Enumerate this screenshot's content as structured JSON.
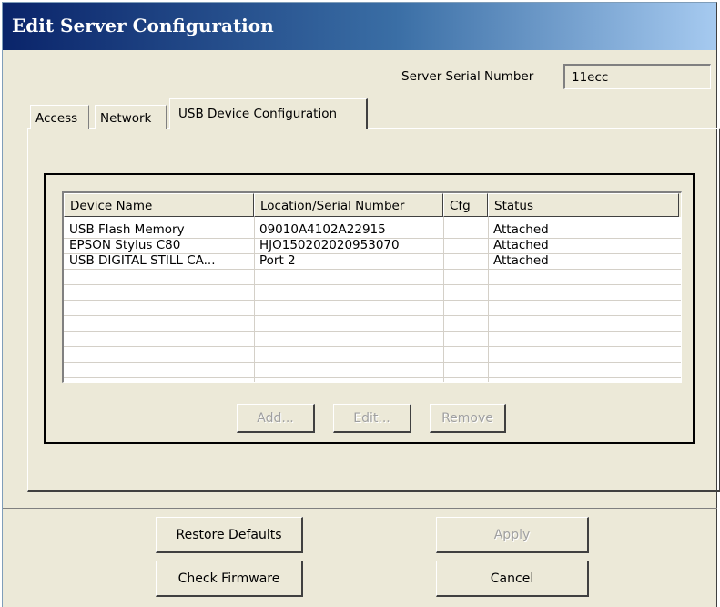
{
  "window": {
    "title": "Edit Server Configuration"
  },
  "server_serial": {
    "label": "Server Serial Number",
    "value": "11ecc"
  },
  "tabs": [
    {
      "label": "Access"
    },
    {
      "label": "Network"
    },
    {
      "label": "USB Device Configuration"
    }
  ],
  "device_list": {
    "columns": [
      "Device Name",
      "Location/Serial Number",
      "Cfg",
      "Status"
    ],
    "rows": [
      {
        "name": "USB Flash Memory",
        "location": "09010A4102A22915",
        "cfg": "",
        "status": "Attached"
      },
      {
        "name": "EPSON Stylus C80",
        "location": "HJO150202020953070",
        "cfg": "",
        "status": "Attached"
      },
      {
        "name": "USB DIGITAL STILL CA...",
        "location": "Port 2",
        "cfg": "",
        "status": "Attached"
      }
    ]
  },
  "device_buttons": {
    "add": "Add...",
    "edit": "Edit...",
    "remove": "Remove"
  },
  "footer_buttons": {
    "restore_defaults": "Restore Defaults",
    "apply": "Apply",
    "check_firmware": "Check Firmware",
    "cancel": "Cancel"
  }
}
